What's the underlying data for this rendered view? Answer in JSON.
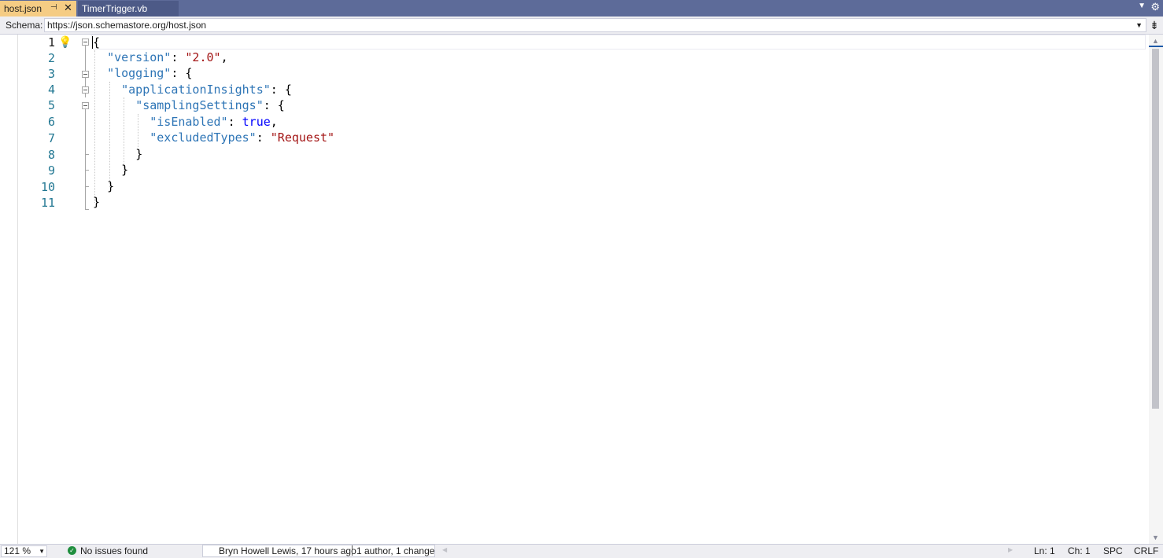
{
  "tabs": {
    "active": {
      "label": "host.json",
      "pin_icon": "pin-icon",
      "close_icon": "close-icon"
    },
    "inactive": {
      "label": "TimerTrigger.vb"
    }
  },
  "schema": {
    "label": "Schema:",
    "value": "https://json.schemastore.org/host.json"
  },
  "editor": {
    "lines": [
      {
        "num": "1"
      },
      {
        "num": "2"
      },
      {
        "num": "3"
      },
      {
        "num": "4"
      },
      {
        "num": "5"
      },
      {
        "num": "6"
      },
      {
        "num": "7"
      },
      {
        "num": "8"
      },
      {
        "num": "9"
      },
      {
        "num": "10"
      },
      {
        "num": "11"
      }
    ],
    "code": {
      "l1": "{",
      "l2_key": "\"version\"",
      "l2_val": "\"2.0\"",
      "l3_key": "\"logging\"",
      "l4_key": "\"applicationInsights\"",
      "l5_key": "\"samplingSettings\"",
      "l6_key": "\"isEnabled\"",
      "l6_val": "true",
      "l7_key": "\"excludedTypes\"",
      "l7_val": "\"Request\"",
      "l8": "}",
      "l9": "}",
      "l10": "}",
      "l11": "}"
    }
  },
  "status": {
    "zoom": "121 %",
    "issues": "No issues found",
    "blame_author": "Bryn Howell Lewis, 17 hours ago",
    "blame_changes": "1 author, 1 change",
    "line": "Ln: 1",
    "char": "Ch: 1",
    "whitespace": "SPC",
    "eol": "CRLF"
  },
  "colors": {
    "tabstrip": "#5d6b99",
    "active_tab": "#f5cc84",
    "json_key": "#2e75b6",
    "json_string": "#a31515",
    "json_keyword": "#0000ff",
    "ok_icon": "#1f8e3e"
  }
}
